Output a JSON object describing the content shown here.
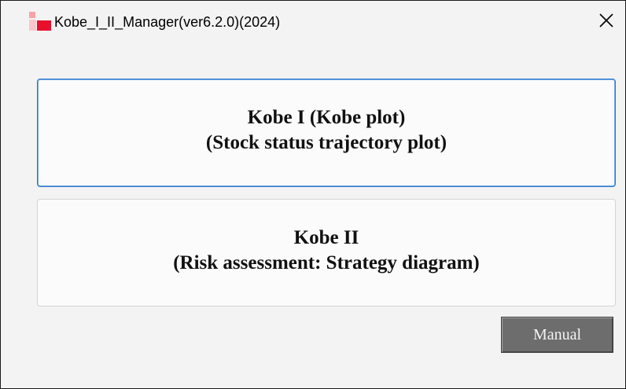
{
  "window": {
    "title": "Kobe_I_II_Manager(ver6.2.0)(2024)",
    "close_icon": "close-icon"
  },
  "buttons": {
    "kobe1": {
      "line1": "Kobe I (Kobe plot)",
      "line2": "(Stock status trajectory plot)"
    },
    "kobe2": {
      "line1": "Kobe II",
      "line2": "(Risk assessment: Strategy diagram)"
    },
    "manual": "Manual"
  },
  "colors": {
    "icon_accent": "#e8112d",
    "focus_border": "#2f77cc",
    "manual_button_bg": "#6d6d6d"
  }
}
